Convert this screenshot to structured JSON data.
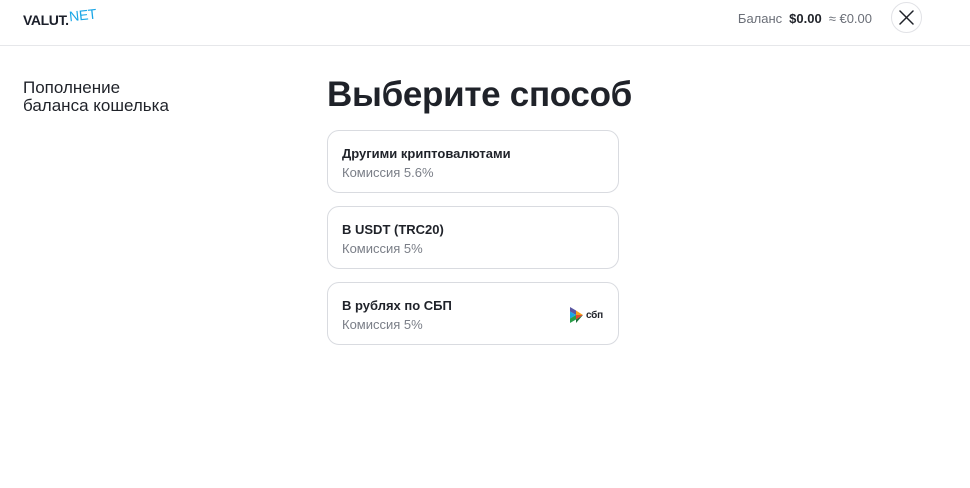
{
  "header": {
    "logo_main": "VALUT.",
    "logo_net": "NET",
    "balance_label": "Баланс",
    "balance_amount": "$0.00",
    "balance_approx": "≈ €0.00",
    "close_icon": "close-icon"
  },
  "sidebar": {
    "title_line1": "Пополнение",
    "title_line2": "баланса кошелька"
  },
  "main": {
    "title": "Выберите способ",
    "methods": [
      {
        "name": "Другими криптовалютами",
        "fee": "Комиссия 5.6%"
      },
      {
        "name": "В USDT (TRC20)",
        "fee": "Комиссия 5%"
      },
      {
        "name": "В рублях по СБП",
        "fee": "Комиссия 5%",
        "logo_text": "сбп",
        "logo_icon": "sbp-icon"
      }
    ]
  },
  "colors": {
    "accent": "#1aa6e6",
    "text": "#1f2229",
    "muted": "#7a7e87",
    "border": "#d9dbe0"
  }
}
